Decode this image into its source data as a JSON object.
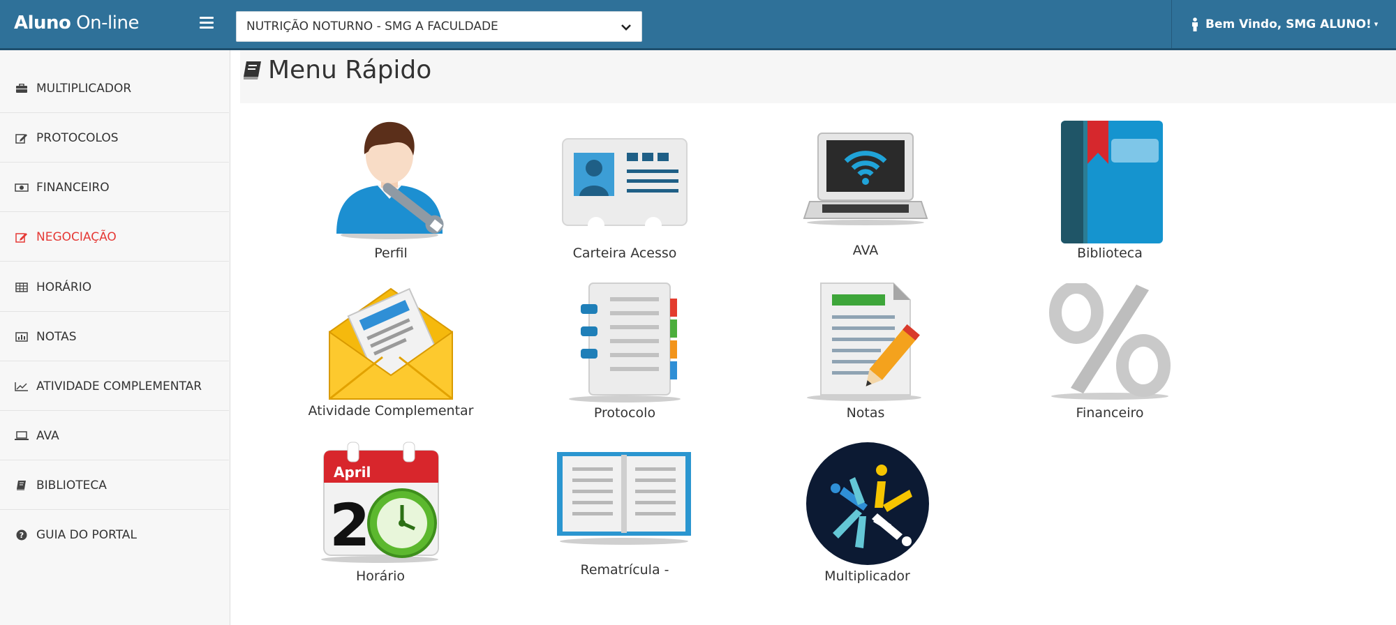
{
  "header": {
    "brand_bold": "Aluno",
    "brand_rest": " On-line",
    "course_selected": "NUTRIÇÃO NOTURNO - SMG A FACULDADE",
    "user_greeting": "Bem Vindo, SMG ALUNO!"
  },
  "sidebar": {
    "items": [
      {
        "label": "MULTIPLICADOR",
        "icon": "briefcase-icon"
      },
      {
        "label": "PROTOCOLOS",
        "icon": "edit-icon"
      },
      {
        "label": "FINANCEIRO",
        "icon": "money-icon"
      },
      {
        "label": "NEGOCIAÇÃO",
        "icon": "edit-icon"
      },
      {
        "label": "HORÁRIO",
        "icon": "table-icon"
      },
      {
        "label": "NOTAS",
        "icon": "bar-chart-icon"
      },
      {
        "label": "ATIVIDADE COMPLEMENTAR",
        "icon": "line-chart-icon"
      },
      {
        "label": "AVA",
        "icon": "laptop-icon"
      },
      {
        "label": "BIBLIOTECA",
        "icon": "book-icon"
      },
      {
        "label": "GUIA DO PORTAL",
        "icon": "question-circle-icon"
      }
    ]
  },
  "main": {
    "title": "Menu Rápido",
    "tiles": [
      {
        "label": "Perfil",
        "icon": "user-wrench-icon"
      },
      {
        "label": "Carteira Acesso",
        "icon": "id-card-icon"
      },
      {
        "label": "AVA",
        "icon": "laptop-wifi-icon"
      },
      {
        "label": "Biblioteca",
        "icon": "blue-book-icon"
      },
      {
        "label": "Atividade Complementar",
        "icon": "envelope-document-icon"
      },
      {
        "label": "Protocolo",
        "icon": "notebook-icon"
      },
      {
        "label": "Notas",
        "icon": "notes-pencil-icon"
      },
      {
        "label": "Financeiro",
        "icon": "percent-icon"
      },
      {
        "label": "Horário",
        "icon": "calendar-clock-icon"
      },
      {
        "label": "Rematrícula -",
        "icon": "open-book-icon"
      },
      {
        "label": "Multiplicador",
        "icon": "multiplicador-logo-icon"
      }
    ],
    "calendar_month": "April",
    "calendar_day": "2"
  },
  "colors": {
    "topbar": "#2f7199",
    "active_sidebar": "#e53935"
  }
}
